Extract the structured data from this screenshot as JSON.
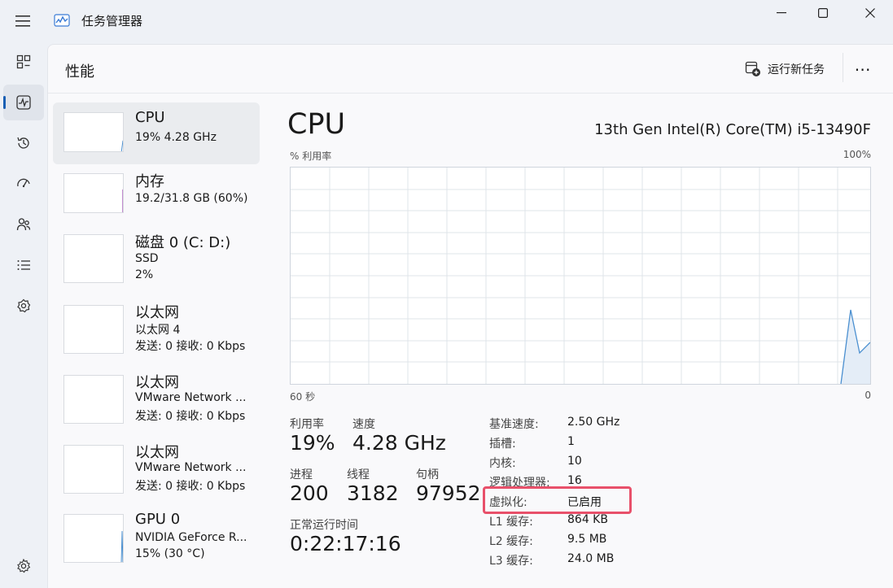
{
  "window": {
    "title": "任务管理器"
  },
  "nav": {
    "items": [
      "processes-icon",
      "performance-icon",
      "app-history-icon",
      "startup-icon",
      "users-icon",
      "details-icon",
      "services-icon"
    ],
    "settings": "gear-icon",
    "accent": "#1a5fb4"
  },
  "header": {
    "page_title": "性能",
    "run_task_label": "运行新任务",
    "more_label": "⋯"
  },
  "resources": [
    {
      "name": "CPU",
      "line1": "19%  4.28 GHz",
      "line2": ""
    },
    {
      "name": "内存",
      "line1": "19.2/31.8 GB (60%)",
      "line2": ""
    },
    {
      "name": "磁盘 0 (C: D:)",
      "line1": "SSD",
      "line2": "2%"
    },
    {
      "name": "以太网",
      "line1": "以太网 4",
      "line2": "发送: 0 接收: 0 Kbps"
    },
    {
      "name": "以太网",
      "line1": "VMware Network ...",
      "line2": "发送: 0 接收: 0 Kbps"
    },
    {
      "name": "以太网",
      "line1": "VMware Network ...",
      "line2": "发送: 0 接收: 0 Kbps"
    },
    {
      "name": "GPU 0",
      "line1": "NVIDIA GeForce R...",
      "line2": "15% (30 °C)"
    }
  ],
  "detail": {
    "title": "CPU",
    "model": "13th Gen Intel(R) Core(TM) i5-13490F",
    "axis_top_left": "% 利用率",
    "axis_top_right": "100%",
    "axis_bottom_left": "60 秒",
    "axis_bottom_right": "0",
    "stats": {
      "utilization_label": "利用率",
      "utilization_value": "19%",
      "speed_label": "速度",
      "speed_value": "4.28 GHz",
      "processes_label": "进程",
      "processes_value": "200",
      "threads_label": "线程",
      "threads_value": "3182",
      "handles_label": "句柄",
      "handles_value": "97952",
      "uptime_label": "正常运行时间",
      "uptime_value": "0:22:17:16"
    },
    "info": [
      {
        "label": "基准速度:",
        "value": "2.50 GHz"
      },
      {
        "label": "插槽:",
        "value": "1"
      },
      {
        "label": "内核:",
        "value": "10"
      },
      {
        "label": "逻辑处理器:",
        "value": "16"
      },
      {
        "label": "虚拟化:",
        "value": "已启用"
      },
      {
        "label": "L1 缓存:",
        "value": "864 KB"
      },
      {
        "label": "L2 缓存:",
        "value": "9.5 MB"
      },
      {
        "label": "L3 缓存:",
        "value": "24.0 MB"
      }
    ],
    "graph_color": "#4a8fd0",
    "highlight_color": "#e8506a"
  }
}
